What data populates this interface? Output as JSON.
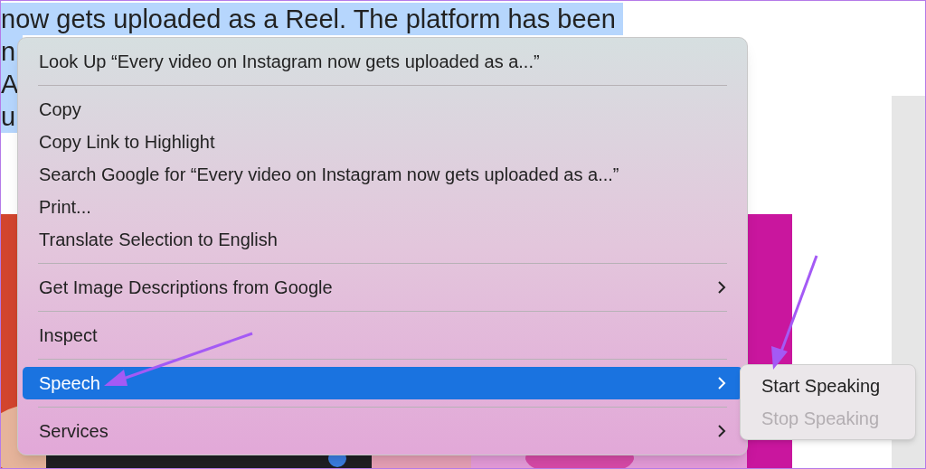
{
  "article": {
    "lines": [
      {
        "text": "now gets uploaded as a Reel. The platform has been",
        "selected": true
      },
      {
        "text": "n",
        "selected": true
      },
      {
        "text": "A",
        "selected": true
      },
      {
        "text": "u",
        "selected": true
      }
    ]
  },
  "context_menu": {
    "items": [
      {
        "kind": "item",
        "label": "Look Up “Every video on Instagram now gets uploaded as a...”",
        "submenu": false,
        "selected": false
      },
      {
        "kind": "separator"
      },
      {
        "kind": "item",
        "label": "Copy",
        "submenu": false,
        "selected": false
      },
      {
        "kind": "item",
        "label": "Copy Link to Highlight",
        "submenu": false,
        "selected": false
      },
      {
        "kind": "item",
        "label": "Search Google for “Every video on Instagram now gets uploaded as a...”",
        "submenu": false,
        "selected": false
      },
      {
        "kind": "item",
        "label": "Print...",
        "submenu": false,
        "selected": false
      },
      {
        "kind": "item",
        "label": "Translate Selection to English",
        "submenu": false,
        "selected": false
      },
      {
        "kind": "separator"
      },
      {
        "kind": "item",
        "label": "Get Image Descriptions from Google",
        "submenu": true,
        "selected": false
      },
      {
        "kind": "separator"
      },
      {
        "kind": "item",
        "label": "Inspect",
        "submenu": false,
        "selected": false
      },
      {
        "kind": "separator"
      },
      {
        "kind": "item",
        "label": "Speech",
        "submenu": true,
        "selected": true
      },
      {
        "kind": "separator"
      },
      {
        "kind": "item",
        "label": "Services",
        "submenu": true,
        "selected": false
      }
    ]
  },
  "submenu": {
    "items": [
      {
        "label": "Start Speaking",
        "disabled": false
      },
      {
        "label": "Stop Speaking",
        "disabled": true
      }
    ]
  }
}
